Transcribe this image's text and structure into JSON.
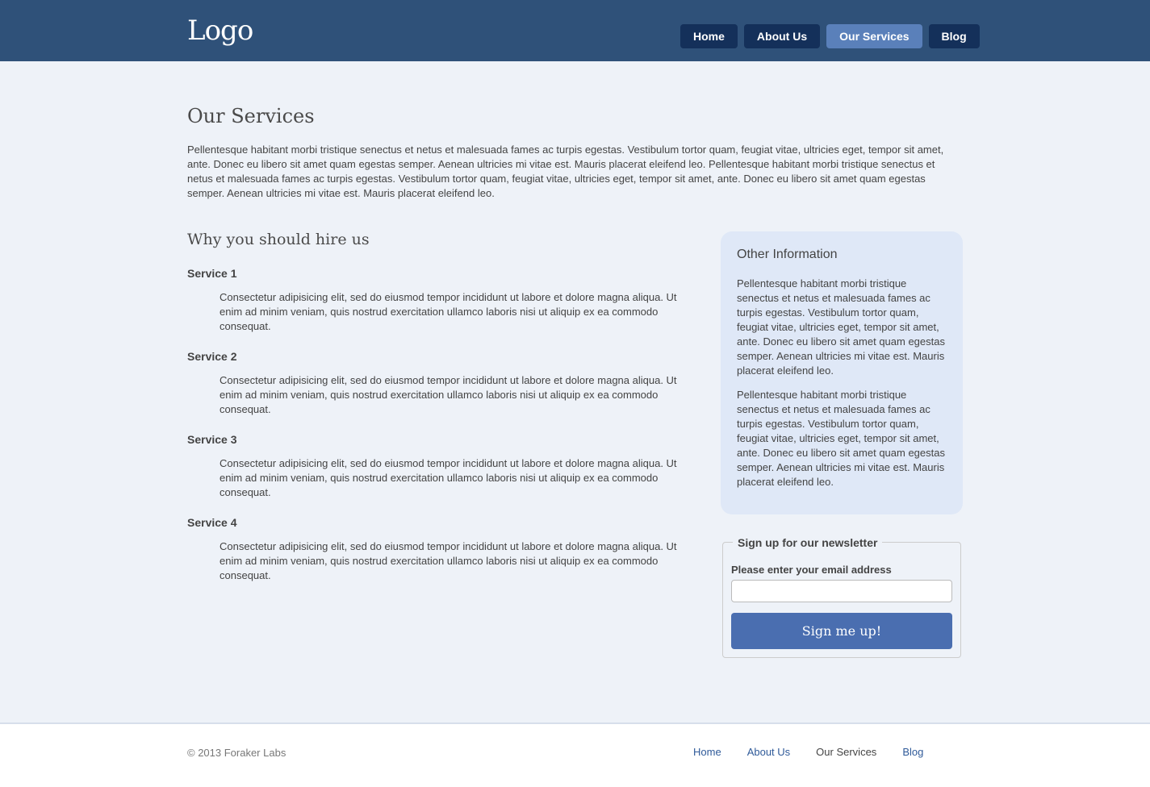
{
  "header": {
    "logo": "Logo",
    "nav": [
      {
        "label": "Home",
        "active": false
      },
      {
        "label": "About Us",
        "active": false
      },
      {
        "label": "Our Services",
        "active": true
      },
      {
        "label": "Blog",
        "active": false
      }
    ]
  },
  "main": {
    "title": "Our Services",
    "intro": "Pellentesque habitant morbi tristique senectus et netus et malesuada fames ac turpis egestas. Vestibulum tortor quam, feugiat vitae, ultricies eget, tempor sit amet, ante. Donec eu libero sit amet quam egestas semper. Aenean ultricies mi vitae est. Mauris placerat eleifend leo. Pellentesque habitant morbi tristique senectus et netus et malesuada fames ac turpis egestas. Vestibulum tortor quam, feugiat vitae, ultricies eget, tempor sit amet, ante. Donec eu libero sit amet quam egestas semper. Aenean ultricies mi vitae est. Mauris placerat eleifend leo.",
    "hire_title": "Why you should hire us",
    "services": [
      {
        "title": "Service 1",
        "description": "Consectetur adipisicing elit, sed do eiusmod tempor incididunt ut labore et dolore magna aliqua. Ut enim ad minim veniam, quis nostrud exercitation ullamco laboris nisi ut aliquip ex ea commodo consequat."
      },
      {
        "title": "Service 2",
        "description": "Consectetur adipisicing elit, sed do eiusmod tempor incididunt ut labore et dolore magna aliqua. Ut enim ad minim veniam, quis nostrud exercitation ullamco laboris nisi ut aliquip ex ea commodo consequat."
      },
      {
        "title": "Service 3",
        "description": "Consectetur adipisicing elit, sed do eiusmod tempor incididunt ut labore et dolore magna aliqua. Ut enim ad minim veniam, quis nostrud exercitation ullamco laboris nisi ut aliquip ex ea commodo consequat."
      },
      {
        "title": "Service 4",
        "description": "Consectetur adipisicing elit, sed do eiusmod tempor incididunt ut labore et dolore magna aliqua. Ut enim ad minim veniam, quis nostrud exercitation ullamco laboris nisi ut aliquip ex ea commodo consequat."
      }
    ]
  },
  "sidebar": {
    "title": "Other Information",
    "paragraphs": [
      "Pellentesque habitant morbi tristique senectus et netus et malesuada fames ac turpis egestas. Vestibulum tortor quam, feugiat vitae, ultricies eget, tempor sit amet, ante. Donec eu libero sit amet quam egestas semper. Aenean ultricies mi vitae est. Mauris placerat eleifend leo.",
      "Pellentesque habitant morbi tristique senectus et netus et malesuada fames ac turpis egestas. Vestibulum tortor quam, feugiat vitae, ultricies eget, tempor sit amet, ante. Donec eu libero sit amet quam egestas semper. Aenean ultricies mi vitae est. Mauris placerat eleifend leo."
    ]
  },
  "newsletter": {
    "legend": "Sign up for our newsletter",
    "email_label": "Please enter your email address",
    "email_value": "",
    "button_label": "Sign me up!"
  },
  "footer": {
    "copyright": "© 2013 Foraker Labs",
    "links": [
      {
        "label": "Home",
        "active": false
      },
      {
        "label": "About Us",
        "active": false
      },
      {
        "label": "Our Services",
        "active": true
      },
      {
        "label": "Blog",
        "active": false
      }
    ]
  },
  "colors": {
    "header_bg": "#2f5179",
    "nav_button": "#14305a",
    "nav_active": "#5a80ba",
    "page_bg": "#eef2f8",
    "sidebar_bg": "#dfe8f7",
    "signup_button": "#4a6eb0",
    "footer_link": "#2f5a99"
  }
}
